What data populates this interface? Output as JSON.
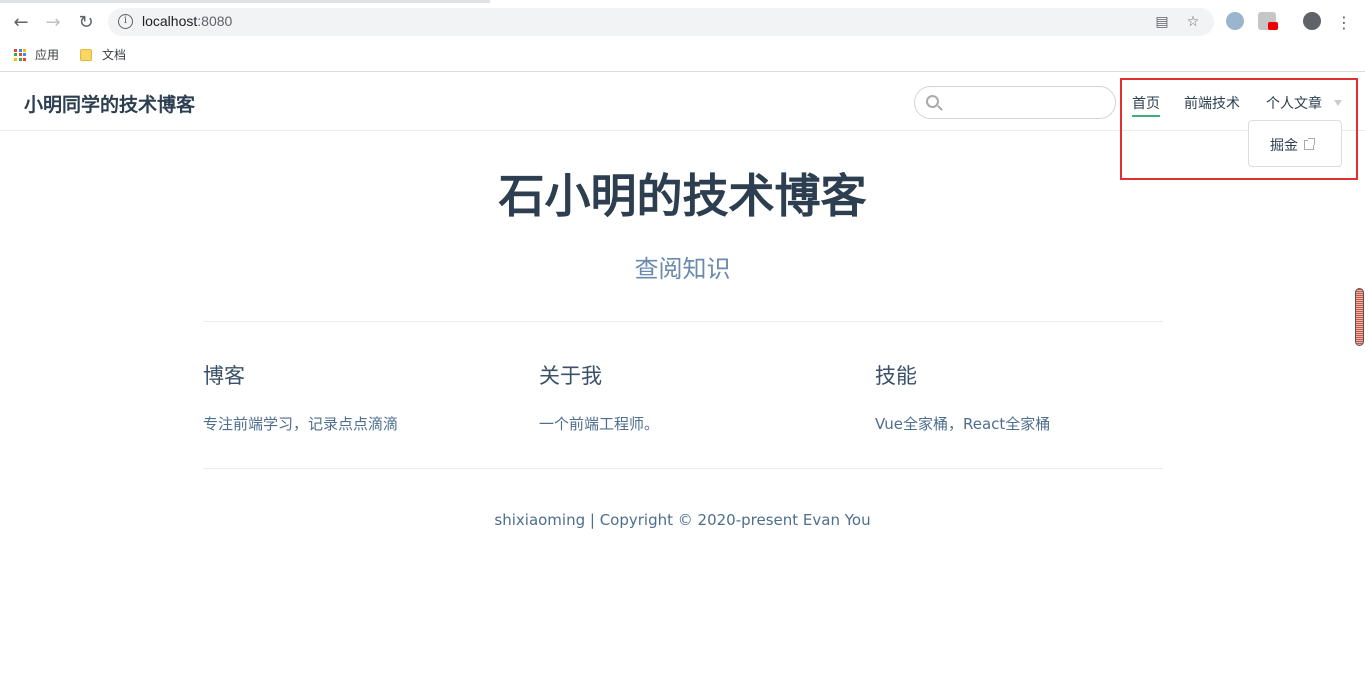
{
  "browser": {
    "url_host": "localhost",
    "url_port": ":8080",
    "bookmarks": [
      {
        "label": "应用",
        "icon": "apps-grid-icon"
      },
      {
        "label": "文档",
        "icon": "folder-icon"
      }
    ],
    "icons": [
      "back-icon",
      "forward-icon",
      "reload-icon",
      "info-icon",
      "translate-icon",
      "star-icon",
      "extension-icon",
      "account-icon",
      "menu-icon"
    ]
  },
  "navbar": {
    "site_name": "小明同学的技术博客",
    "search_placeholder": "",
    "links": [
      {
        "label": "首页",
        "active": true
      },
      {
        "label": "前端技术",
        "active": false
      },
      {
        "label": "个人文章",
        "active": false
      }
    ],
    "dropdown": {
      "items": [
        {
          "label": "掘金",
          "external": true
        }
      ]
    }
  },
  "hero": {
    "title": "石小明的技术博客",
    "description": "查阅知识"
  },
  "features": [
    {
      "title": "博客",
      "details": "专注前端学习，记录点点滴滴"
    },
    {
      "title": "关于我",
      "details": "一个前端工程师。"
    },
    {
      "title": "技能",
      "details": "Vue全家桶，React全家桶"
    }
  ],
  "footer": {
    "text": "shixiaoming | Copyright © 2020-present Evan You"
  },
  "colors": {
    "accent": "#3eaf7c",
    "text": "#2c3e50",
    "highlight_border": "#e0302f"
  }
}
